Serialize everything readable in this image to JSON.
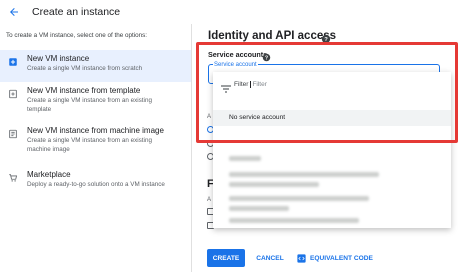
{
  "header": {
    "title": "Create an instance"
  },
  "left_panel": {
    "intro": "To create a VM instance, select one of the options:",
    "options": [
      {
        "title": "New VM instance",
        "desc": "Create a single VM instance from scratch"
      },
      {
        "title": "New VM instance from template",
        "desc": "Create a single VM instance from an existing template"
      },
      {
        "title": "New VM instance from machine image",
        "desc": "Create a single VM instance from an existing machine image"
      },
      {
        "title": "Marketplace",
        "desc": "Deploy a ready-to-go solution onto a VM instance"
      }
    ]
  },
  "main": {
    "section_title": "Identity and API access"
  },
  "service_accounts": {
    "title": "Service accounts",
    "field_label": "Service account",
    "filter_label": "Filter",
    "filter_placeholder": "Filter",
    "none_option": "No service account"
  },
  "background": {
    "partial_label": "A",
    "partial_heading": "F"
  },
  "actions": {
    "create": "CREATE",
    "cancel": "CANCEL",
    "equivalent_code": "EQUIVALENT CODE"
  },
  "colors": {
    "accent": "#1a73e8",
    "highlight": "#e53935",
    "selected_bg": "#e8f0fe"
  },
  "icons": [
    "back-arrow-icon",
    "add-vm-icon",
    "template-icon",
    "machine-image-icon",
    "cart-icon",
    "help-icon",
    "filter-icon",
    "code-icon"
  ]
}
